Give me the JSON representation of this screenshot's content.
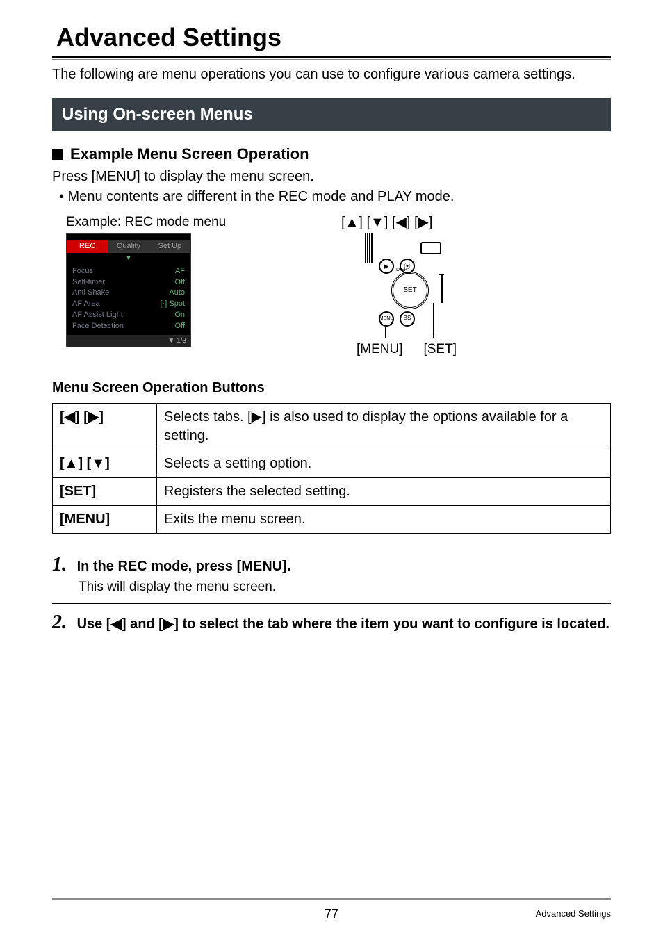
{
  "title": "Advanced Settings",
  "intro": "The following are menu operations you can use to configure various camera settings.",
  "section_bar": "Using On-screen Menus",
  "h3": "Example Menu Screen Operation",
  "press_text": "Press [MENU] to display the menu screen.",
  "bullet_text": "• Menu contents are different in the REC mode and PLAY mode.",
  "example_label": "Example: REC mode menu",
  "arrows_label": "[▲] [▼] [◀] [▶]",
  "camera_screen": {
    "tabs": [
      "REC",
      "Quality",
      "Set Up"
    ],
    "tab_arrow_down": "▼",
    "items": [
      {
        "name": "Focus",
        "val": "AF"
      },
      {
        "name": "Self-timer",
        "val": "Off"
      },
      {
        "name": "Anti Shake",
        "val": "Auto"
      },
      {
        "name": "AF Area",
        "val": "[·] Spot"
      },
      {
        "name": "AF Assist Light",
        "val": "On"
      },
      {
        "name": "Face Detection",
        "val": "Off"
      }
    ],
    "page_ind": "▼ 1/3"
  },
  "diagram": {
    "wheel_label": "SET",
    "menu_btn": "MENU",
    "bs_btn": "BS",
    "disp_label": "DISP",
    "menu_label": "[MENU]",
    "set_label": "[SET]"
  },
  "table_title": "Menu Screen Operation Buttons",
  "table": [
    {
      "key": "[◀] [▶]",
      "desc": "Selects tabs. [▶] is also used to display the options available for a setting."
    },
    {
      "key": "[▲] [▼]",
      "desc": "Selects a setting option."
    },
    {
      "key": "[SET]",
      "desc": "Registers the selected setting."
    },
    {
      "key": "[MENU]",
      "desc": "Exits the menu screen."
    }
  ],
  "steps": [
    {
      "num": "1.",
      "title": "In the REC mode, press [MENU].",
      "body": "This will display the menu screen."
    },
    {
      "num": "2.",
      "title": "Use [◀] and [▶] to select the tab where the item you want to configure is located.",
      "body": ""
    }
  ],
  "footer": {
    "page": "77",
    "crumb": "Advanced Settings"
  }
}
